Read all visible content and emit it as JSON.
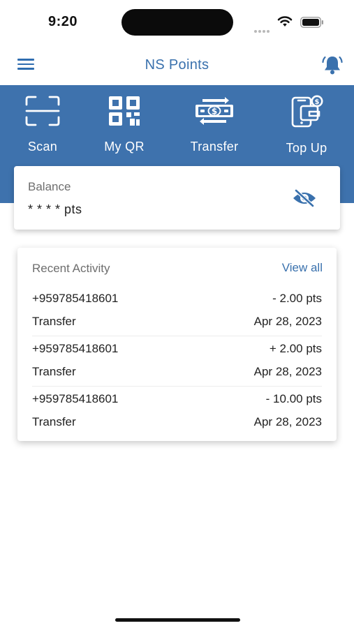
{
  "status_bar": {
    "time": "9:20",
    "icons": [
      "signal-icon",
      "wifi-icon",
      "battery-icon"
    ]
  },
  "app_bar": {
    "title": "NS Points",
    "left_icon": "menu-icon",
    "right_icon": "bell-icon"
  },
  "theme": {
    "primary": "#3e72ad",
    "accent_text": "#3a71ad",
    "card_bg": "#ffffff"
  },
  "actions": [
    {
      "label": "Scan",
      "icon": "scan-icon"
    },
    {
      "label": "My QR",
      "icon": "qr-code-icon"
    },
    {
      "label": "Transfer",
      "icon": "money-transfer-icon"
    },
    {
      "label": "Top Up",
      "icon": "wallet-topup-icon"
    }
  ],
  "balance": {
    "label": "Balance",
    "value": "* * * * pts",
    "toggle_icon": "eye-off-icon"
  },
  "activity": {
    "title": "Recent Activity",
    "view_all": "View all",
    "rows": [
      {
        "phone": "+959785418601",
        "amount": "- 2.00 pts",
        "type": "Transfer",
        "date": "Apr 28, 2023"
      },
      {
        "phone": "+959785418601",
        "amount": "+ 2.00 pts",
        "type": "Transfer",
        "date": "Apr 28, 2023"
      },
      {
        "phone": "+959785418601",
        "amount": "- 10.00 pts",
        "type": "Transfer",
        "date": "Apr 28, 2023"
      }
    ]
  }
}
